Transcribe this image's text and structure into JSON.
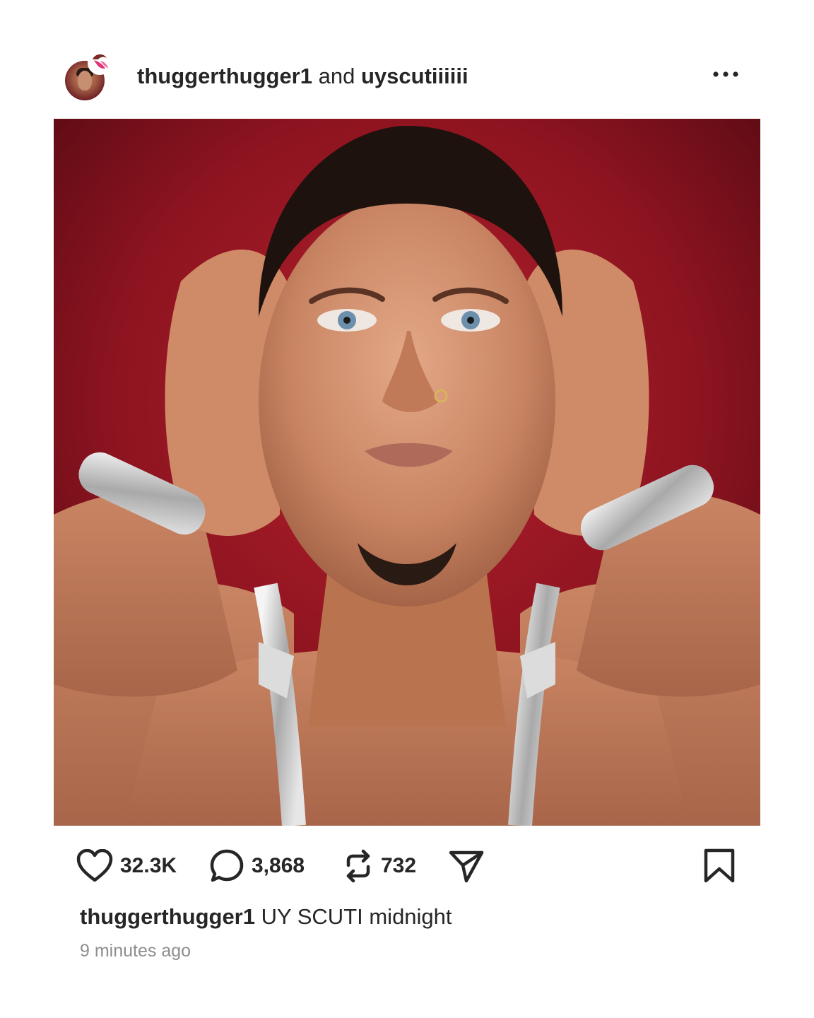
{
  "post": {
    "header": {
      "author": "thuggerthugger1",
      "joiner": "and",
      "collaborator": "uyscutiiiiii",
      "more_icon": "more-horizontal-icon"
    },
    "photo": {
      "background_color": "#8d1420",
      "description_icon": "post-photo"
    },
    "actions": {
      "like_count": "32.3K",
      "comment_count": "3,868",
      "repost_count": "732",
      "icons": [
        "heart-icon",
        "comment-icon",
        "repost-icon",
        "share-icon",
        "bookmark-icon"
      ]
    },
    "caption": {
      "username": "thuggerthugger1",
      "text": "UY SCUTI midnight"
    },
    "timestamp": "9 minutes ago"
  },
  "colors": {
    "text_primary": "#262626",
    "text_secondary": "#8e8e8e",
    "background": "#ffffff"
  }
}
